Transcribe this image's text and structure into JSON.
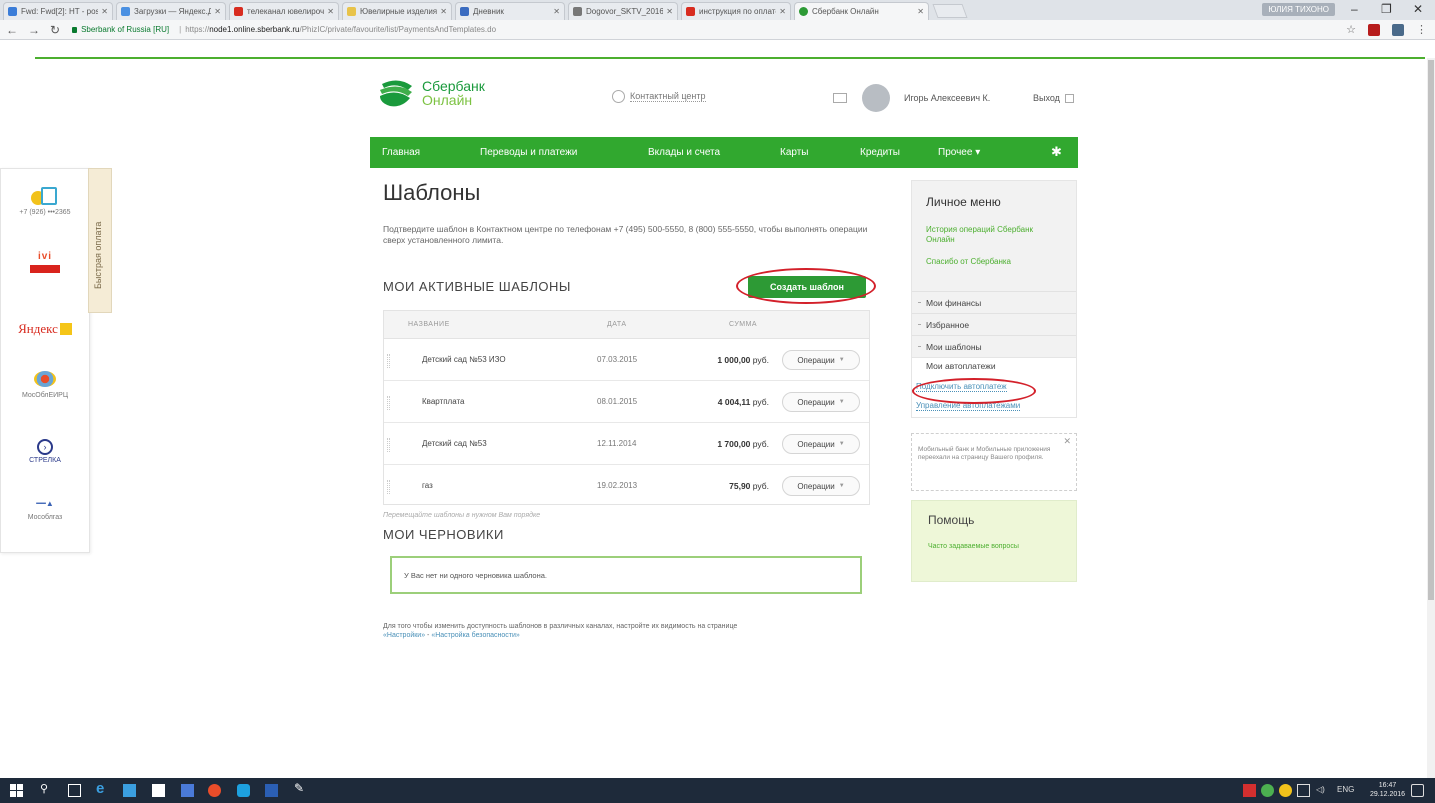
{
  "browser": {
    "tabs": [
      {
        "label": "Fwd: Fwd[2]: HT - postu",
        "color": "#3b7dd8"
      },
      {
        "label": "Загрузки — Яндекс.Дис",
        "color": "#4a90e2"
      },
      {
        "label": "телеканал ювелирочк",
        "color": "#d82c20"
      },
      {
        "label": "Ювелирные изделия |",
        "color": "#e8c34a"
      },
      {
        "label": "Дневник",
        "color": "#3b6cc0"
      },
      {
        "label": "Dogovor_SKTV_2016.pdf",
        "color": "#777777"
      },
      {
        "label": "инструкция по оплате",
        "color": "#d82c20"
      },
      {
        "label": "Сбербанк Онлайн",
        "color": "#2d9a35"
      }
    ],
    "window_user": "ЮЛИЯ ТИХОНО",
    "secure_label": "Sberbank of Russia [RU]",
    "url_prefix": "https://",
    "url_host": "node1.online.sberbank.ru",
    "url_path": "/PhizIC/private/favourite/list/PaymentsAndTemplates.do"
  },
  "header": {
    "logo_line1": "Сбербанк",
    "logo_line2": "Онлайн",
    "contact_center": "Контактный центр",
    "username": "Игорь Алексеевич К.",
    "logout": "Выход"
  },
  "menu": {
    "items": [
      "Главная",
      "Переводы и платежи",
      "Вклады и счета",
      "Карты",
      "Кредиты",
      "Прочее"
    ]
  },
  "left_panel": {
    "quick_pay": "Быстрая оплата",
    "phone": "+7 (926) •••2365",
    "ivi_brand": "ivi",
    "yandex_label": "Яндекс",
    "mos_label": "МосОблЕИРЦ",
    "strelka_label": "СТРЕЛКА",
    "mosoblgaz_label": "Мособлгаз"
  },
  "main": {
    "title": "Шаблоны",
    "intro": "Подтвердите шаблон в Контактном центре по телефонам +7 (495) 500-5550, 8 (800) 555-5550, чтобы выполнять операции сверх установленного лимита.",
    "active_title": "МОИ АКТИВНЫЕ ШАБЛОНЫ",
    "create_btn": "Создать шаблон",
    "table_headers": {
      "name": "НАЗВАНИЕ",
      "date": "ДАТА",
      "sum": "СУММА"
    },
    "op_label": "Операции",
    "rows": [
      {
        "name": "Детский сад №53 ИЗО",
        "date": "07.03.2015",
        "amount": "1 000,00",
        "cur": "руб."
      },
      {
        "name": "Квартплата",
        "date": "08.01.2015",
        "amount": "4 004,11",
        "cur": "руб."
      },
      {
        "name": "Детский сад №53",
        "date": "12.11.2014",
        "amount": "1 700,00",
        "cur": "руб."
      },
      {
        "name": "газ",
        "date": "19.02.2013",
        "amount": "75,90",
        "cur": "руб."
      }
    ],
    "reorder_hint": "Перемещайте шаблоны в нужном Вам порядке",
    "drafts_title": "МОИ ЧЕРНОВИКИ",
    "drafts_empty": "У Вас нет ни одного черновика шаблона.",
    "footnote_text": "Для того чтобы изменить доступность шаблонов в различных каналах, настройте их видимость на странице",
    "footnote_link1": "«Настройки»",
    "footnote_link_sep": " - ",
    "footnote_link2": "«Настройка безопасности»"
  },
  "sidebar": {
    "title": "Личное меню",
    "link_history": "История операций Сбербанк Онлайн",
    "link_thanks": "Спасибо от Сбербанка",
    "items": [
      "Мои финансы",
      "Избранное",
      "Мои шаблоны"
    ],
    "autopay_header": "Мои автоплатежи",
    "autopay_connect": "Подключить автоплатеж",
    "autopay_manage": "Управление автоплатежами",
    "notice": "Мобильный банк и Мобильные приложения переехали на страницу Вашего профиля.",
    "help_title": "Помощь",
    "help_link": "Часто задаваемые вопросы"
  },
  "taskbar": {
    "lang": "ENG",
    "time": "16:47",
    "date": "29.12.2016"
  },
  "colors": {
    "brand_green": "#31a82f",
    "button_green": "#2d9a35",
    "annotation_red": "#d3202a"
  }
}
